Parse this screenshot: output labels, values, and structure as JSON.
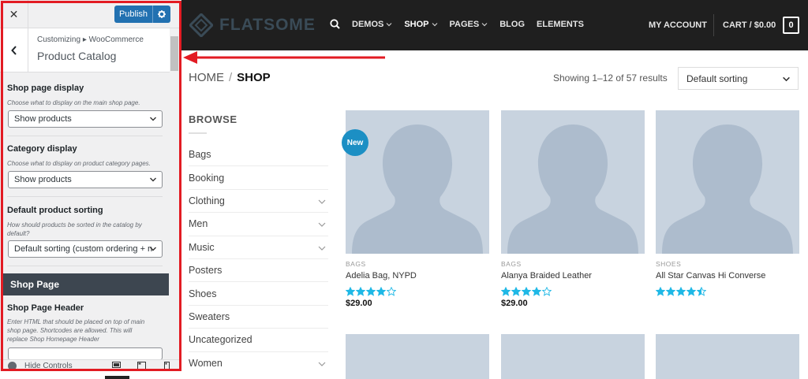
{
  "customizer": {
    "close_label": "✕",
    "publish_label": "Publish",
    "breadcrumb_root": "Customizing",
    "breadcrumb_sep": "▸",
    "breadcrumb_section": "WooCommerce",
    "title": "Product Catalog",
    "controls": {
      "shop_display": {
        "label": "Shop page display",
        "description": "Choose what to display on the main shop page.",
        "value": "Show products"
      },
      "category_display": {
        "label": "Category display",
        "description": "Choose what to display on product category pages.",
        "value": "Show products"
      },
      "default_sorting": {
        "label": "Default product sorting",
        "description": "How should products be sorted in the catalog by default?",
        "value": "Default sorting (custom ordering + n"
      }
    },
    "section_title": "Shop Page",
    "shop_header": {
      "label": "Shop Page Header",
      "description": "Enter HTML that should be placed on top of main shop page. Shortcodes are allowed. This will replace Shop Homepage Header"
    },
    "footer": {
      "hide_controls": "Hide Controls"
    }
  },
  "header": {
    "logo_text": "FLATSOME",
    "nav": {
      "demos": "DEMOS",
      "shop": "SHOP",
      "pages": "PAGES",
      "blog": "BLOG",
      "elements": "ELEMENTS"
    },
    "account": "MY ACCOUNT",
    "cart": "CART / $0.00",
    "cart_count": "0"
  },
  "shop": {
    "breadcrumb_home": "HOME",
    "breadcrumb_sep": "/",
    "breadcrumb_current": "SHOP",
    "results": "Showing 1–12 of 57 results",
    "sort_value": "Default sorting",
    "sidebar": {
      "title": "BROWSE",
      "categories": [
        {
          "name": "Bags",
          "expandable": false
        },
        {
          "name": "Booking",
          "expandable": false
        },
        {
          "name": "Clothing",
          "expandable": true
        },
        {
          "name": "Men",
          "expandable": true
        },
        {
          "name": "Music",
          "expandable": true
        },
        {
          "name": "Posters",
          "expandable": false
        },
        {
          "name": "Shoes",
          "expandable": false
        },
        {
          "name": "Sweaters",
          "expandable": false
        },
        {
          "name": "Uncategorized",
          "expandable": false
        },
        {
          "name": "Women",
          "expandable": true
        }
      ]
    },
    "badge_new": "New",
    "products": [
      {
        "category": "BAGS",
        "name": "Adelia Bag, NYPD",
        "rating": 4,
        "price": "$29.00"
      },
      {
        "category": "BAGS",
        "name": "Alanya Braided Leather",
        "rating": 4,
        "price": "$29.00"
      },
      {
        "category": "SHOES",
        "name": "All Star Canvas Hi Converse",
        "rating": 4.5,
        "price": ""
      }
    ]
  },
  "colors": {
    "publish": "#2271b1",
    "highlight": "#e21b23",
    "header_bg": "#1f1f1f",
    "section_bar": "#3d4650",
    "badge": "#1c8fc4",
    "star": "#1fb8e6",
    "placeholder": "#c8d3df"
  }
}
